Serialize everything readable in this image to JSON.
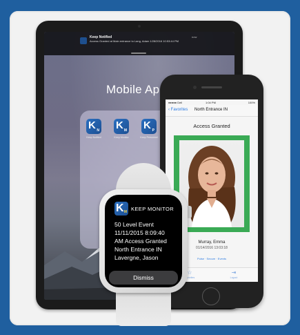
{
  "ipad": {
    "notification": {
      "title": "Keep Notified",
      "time": "now",
      "body": "Access Granted at Main entrance to Lang, Adam 1/28/2016 10:53:44 PM"
    },
    "heading": "Mobile Apps",
    "apps": [
      {
        "label": "Keep Notified",
        "letter": "K",
        "sub": "N"
      },
      {
        "label": "Keep Monitor",
        "letter": "K",
        "sub": "M"
      },
      {
        "label": "Keep Personnel",
        "letter": "K",
        "sub": "P"
      }
    ]
  },
  "iphone": {
    "status": {
      "carrier": "●●●●● Dell",
      "time": "1:04 PM",
      "battery": "100%"
    },
    "nav": {
      "back_label": "‹ Favorites",
      "title": "North Entrance IN"
    },
    "status_text": "Access Granted",
    "person_name": "Murray, Emma",
    "timestamp": "01/14/2016 13:03:18",
    "links": "Pulse  ·  Secure  ·  Events",
    "tabs": [
      {
        "icon": "star-icon",
        "glyph": "☆",
        "label": "Favorites"
      },
      {
        "icon": "logout-icon",
        "glyph": "⇥",
        "label": "Logout"
      }
    ]
  },
  "watch": {
    "app_name": "KEEP MONITOR",
    "message_lines": [
      "50 Level Event",
      "11/11/2015 8:09:40",
      "AM Access Granted",
      "North Entrance IN",
      "Lavergne, Jason"
    ],
    "dismiss_label": "Dismiss"
  },
  "colors": {
    "page_bg": "#1f5f9f",
    "app_blue": "#1d4f92",
    "access_green": "#3aaa55",
    "ios_blue": "#2a7ae2"
  }
}
